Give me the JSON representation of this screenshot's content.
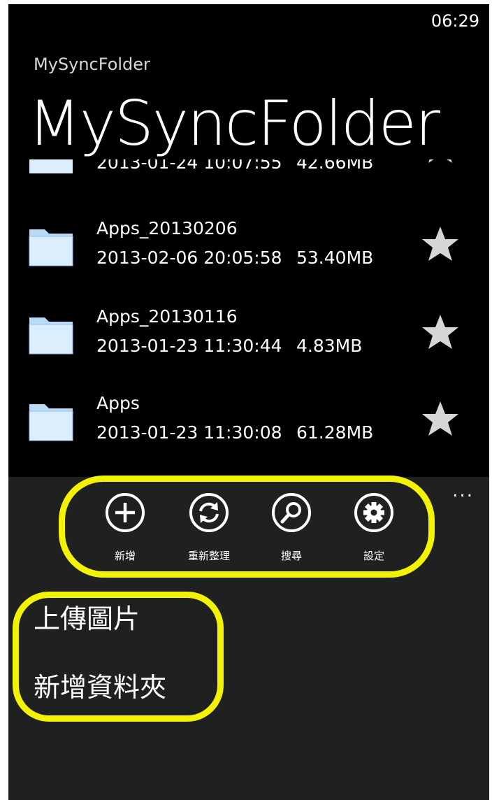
{
  "status_bar": {
    "time": "06:29"
  },
  "app_name": "MySyncFolder",
  "page_title": "MySyncFolder",
  "partial_item": {
    "date": "2013-01-24 10:07:55",
    "size": "42.66MB"
  },
  "files": [
    {
      "name": "Apps_20130206",
      "date": "2013-02-06 20:05:58",
      "size": "53.40MB"
    },
    {
      "name": "Apps_20130116",
      "date": "2013-01-23 11:30:44",
      "size": "4.83MB"
    },
    {
      "name": "Apps",
      "date": "2013-01-23 11:30:08",
      "size": "61.28MB"
    }
  ],
  "app_bar": {
    "more": "...",
    "buttons": [
      {
        "icon": "add-icon",
        "label": "新增"
      },
      {
        "icon": "refresh-icon",
        "label": "重新整理"
      },
      {
        "icon": "search-icon",
        "label": "搜尋"
      },
      {
        "icon": "settings-icon",
        "label": "設定"
      }
    ],
    "menu_items": [
      "上傳圖片",
      "新增資料夾"
    ]
  },
  "colors": {
    "highlight": "#f3f200",
    "appbar_bg": "#1f2120",
    "folder_light": "#dbeefe",
    "folder_dark": "#8fc3ef",
    "star": "#d6d6d6"
  }
}
